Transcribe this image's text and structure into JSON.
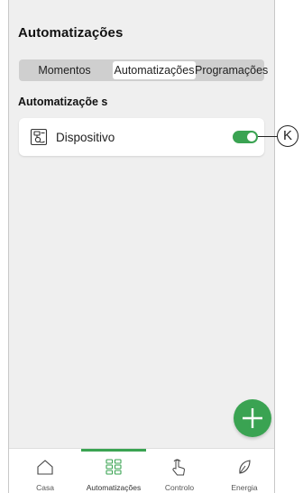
{
  "header": {
    "title": "Automatizações"
  },
  "tabs": [
    {
      "label": "Momentos",
      "active": false
    },
    {
      "label": "Automatizações",
      "active": true
    },
    {
      "label": "Programações",
      "active": false
    }
  ],
  "section": {
    "title": "Automatizaçõe s"
  },
  "automations": [
    {
      "label": "Dispositivo",
      "icon": "device-automation-icon",
      "enabled": true
    }
  ],
  "callout": {
    "label": "K"
  },
  "fab": {
    "icon": "plus-icon"
  },
  "bottom_nav": [
    {
      "label": "Casa",
      "icon": "home-icon",
      "active": false
    },
    {
      "label": "Automatizações",
      "icon": "grid-icon",
      "active": true
    },
    {
      "label": "Controlo",
      "icon": "hand-touch-icon",
      "active": false
    },
    {
      "label": "Energia",
      "icon": "leaf-icon",
      "active": false
    }
  ],
  "colors": {
    "accent": "#3aa352",
    "background": "#efefef",
    "card": "#ffffff",
    "segment_bg": "#cfcfcf"
  }
}
